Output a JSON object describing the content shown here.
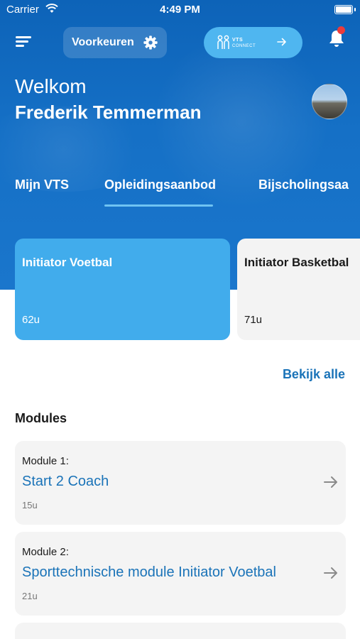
{
  "status_bar": {
    "carrier": "Carrier",
    "time": "4:49 PM"
  },
  "header": {
    "preferences_label": "Voorkeuren",
    "vts_connect": {
      "line1": "VTS",
      "line2": "CONNECT"
    },
    "notification_dot_color": "#ec3b3b"
  },
  "greeting": {
    "welcome": "Welkom",
    "name": "Frederik Temmerman"
  },
  "tabs": [
    {
      "label": "Mijn VTS",
      "active": false
    },
    {
      "label": "Opleidingsaanbod",
      "active": true
    },
    {
      "label": "Bijscholingsaa",
      "active": false
    }
  ],
  "courses": [
    {
      "title": "Initiator Voetbal",
      "hours": "62u"
    },
    {
      "title": "Initiator Basketbal",
      "hours": "71u"
    }
  ],
  "see_all_label": "Bekijk alle",
  "modules_title": "Modules",
  "modules": [
    {
      "label": "Module 1:",
      "title": "Start 2 Coach",
      "hours": "15u"
    },
    {
      "label": "Module 2:",
      "title": "Sporttechnische module Initiator Voetbal",
      "hours": "21u"
    }
  ],
  "colors": {
    "primary_blue": "#0d63b8",
    "accent_blue": "#41acec",
    "link_blue": "#1a73b8"
  }
}
